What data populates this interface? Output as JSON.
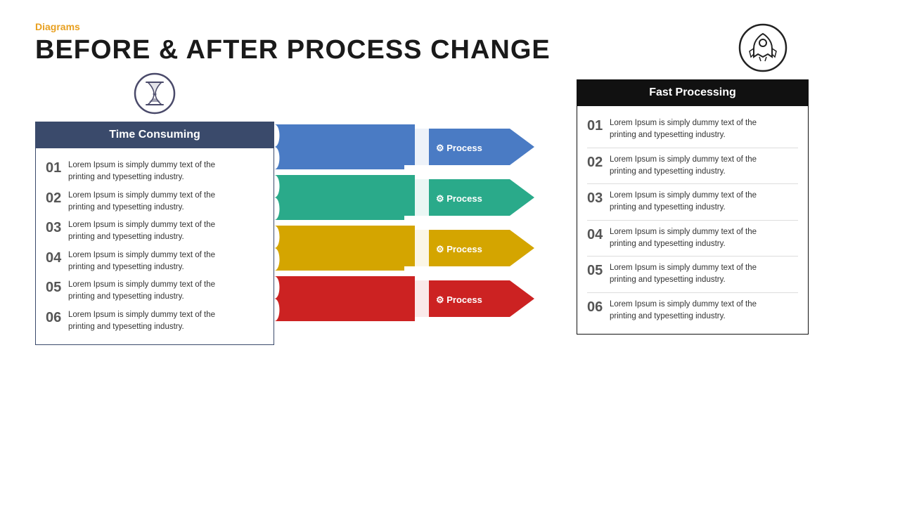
{
  "header": {
    "category": "Diagrams",
    "title": "BEFORE & AFTER PROCESS CHANGE"
  },
  "left_panel": {
    "header": "Time Consuming",
    "icon_label": "hourglass-icon",
    "items": [
      {
        "num": "01",
        "text": "Lorem Ipsum is simply dummy text of the\nprinting and typesetting industry."
      },
      {
        "num": "02",
        "text": "Lorem Ipsum is simply dummy text of the\nprinting and typesetting industry."
      },
      {
        "num": "03",
        "text": "Lorem Ipsum is simply dummy text of the\nprinting and typesetting industry."
      },
      {
        "num": "04",
        "text": "Lorem Ipsum is simply dummy text of the\nprinting and typesetting industry."
      },
      {
        "num": "05",
        "text": "Lorem Ipsum is simply dummy text of the\nprinting and typesetting industry."
      },
      {
        "num": "06",
        "text": "Lorem Ipsum is simply dummy text of the\nprinting and typesetting industry."
      }
    ]
  },
  "process_rows": [
    {
      "label": "Process",
      "color": "#4a7bc4",
      "band_color": "#4a7bc4",
      "white_band": true
    },
    {
      "label": "Process",
      "color": "#2aaa8a",
      "band_color": "#2aaa8a",
      "white_band": true
    },
    {
      "label": "Process",
      "color": "#d4a500",
      "band_color": "#d4a500",
      "white_band": true
    },
    {
      "label": "Process",
      "color": "#cc2222",
      "band_color": "#cc2222",
      "white_band": true
    }
  ],
  "right_panel": {
    "header": "Fast Processing",
    "icon_label": "rocket-icon",
    "items": [
      {
        "num": "01",
        "text": "Lorem Ipsum is simply dummy text of the\nprinting and typesetting industry."
      },
      {
        "num": "02",
        "text": "Lorem Ipsum is simply dummy text of the\nprinting and typesetting industry."
      },
      {
        "num": "03",
        "text": "Lorem Ipsum is simply dummy text of the\nprinting and typesetting industry."
      },
      {
        "num": "04",
        "text": "Lorem Ipsum is simply dummy text of the\nprinting and typesetting industry."
      },
      {
        "num": "05",
        "text": "Lorem Ipsum is simply dummy text of the\nprinting and typesetting industry."
      },
      {
        "num": "06",
        "text": "Lorem Ipsum is simply dummy text of the\nprinting and typesetting industry."
      }
    ]
  },
  "colors": {
    "accent": "#e8a020",
    "title": "#1a1a1a",
    "left_header_bg": "#3a4a6b",
    "right_header_bg": "#111111",
    "blue": "#4a7bc4",
    "teal": "#2aaa8a",
    "yellow": "#d4a500",
    "red": "#cc2222"
  }
}
